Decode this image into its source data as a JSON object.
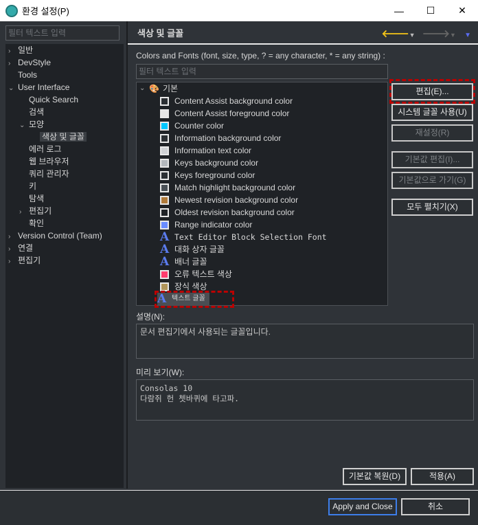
{
  "window": {
    "title": "환경 설정(P)",
    "controls": [
      "—",
      "☐",
      "✕"
    ]
  },
  "sidebar": {
    "filter_placeholder": "필터 텍스트 입력",
    "items": [
      {
        "label": "일반",
        "level": 0,
        "arrow": "›"
      },
      {
        "label": "DevStyle",
        "level": 0,
        "arrow": "›"
      },
      {
        "label": "Tools",
        "level": 0,
        "arrow": ""
      },
      {
        "label": "User Interface",
        "level": 0,
        "arrow": "⌄"
      },
      {
        "label": "Quick Search",
        "level": 1,
        "arrow": ""
      },
      {
        "label": "검색",
        "level": 1,
        "arrow": ""
      },
      {
        "label": "모양",
        "level": 1,
        "arrow": "⌄"
      },
      {
        "label": "색상 및 글꼴",
        "level": 2,
        "arrow": "",
        "selected": true
      },
      {
        "label": "에러 로그",
        "level": 1,
        "arrow": ""
      },
      {
        "label": "웹 브라우저",
        "level": 1,
        "arrow": ""
      },
      {
        "label": "쿼리 관리자",
        "level": 1,
        "arrow": ""
      },
      {
        "label": "키",
        "level": 1,
        "arrow": ""
      },
      {
        "label": "탐색",
        "level": 1,
        "arrow": ""
      },
      {
        "label": "편집기",
        "level": 1,
        "arrow": "›"
      },
      {
        "label": "확인",
        "level": 1,
        "arrow": ""
      },
      {
        "label": "Version Control (Team)",
        "level": 0,
        "arrow": "›"
      },
      {
        "label": "연결",
        "level": 0,
        "arrow": "›"
      },
      {
        "label": "편집기",
        "level": 0,
        "arrow": "›"
      }
    ]
  },
  "page": {
    "title": "색상 및 글꼴",
    "intro": "Colors and Fonts (font, size, type, ? = any character, * = any string) :",
    "filter_placeholder": "필터 텍스트 입력",
    "category": "기본",
    "entries": [
      {
        "label": "Content Assist background color",
        "type": "color",
        "color": "#2b2f33"
      },
      {
        "label": "Content Assist foreground color",
        "type": "color",
        "color": "#e6e6e6"
      },
      {
        "label": "Counter color",
        "type": "color",
        "color": "#00c8ff"
      },
      {
        "label": "Information background color",
        "type": "color",
        "color": "#2b2f33"
      },
      {
        "label": "Information text color",
        "type": "color",
        "color": "#cfd1d4"
      },
      {
        "label": "Keys background color",
        "type": "color",
        "color": "#b4b8bd"
      },
      {
        "label": "Keys foreground color",
        "type": "color",
        "color": "#2b2f33"
      },
      {
        "label": "Match highlight background color",
        "type": "color",
        "color": "#4a5056"
      },
      {
        "label": "Newest revision background color",
        "type": "color",
        "color": "#b07a3a"
      },
      {
        "label": "Oldest revision background color",
        "type": "color",
        "color": "#1f2226"
      },
      {
        "label": "Range indicator color",
        "type": "color",
        "color": "#6a8cff"
      },
      {
        "label": "Text Editor Block Selection Font",
        "type": "font",
        "mono": true
      },
      {
        "label": "대화 상자 글꼴",
        "type": "font"
      },
      {
        "label": "배너 글꼴",
        "type": "font"
      },
      {
        "label": "오류 텍스트 색상",
        "type": "color",
        "color": "#ff3d6e"
      },
      {
        "label": "장식 색상",
        "type": "color",
        "color": "#b0955a"
      },
      {
        "label": "텍스트 글꼴",
        "type": "font",
        "selected": true
      }
    ],
    "buttons": {
      "edit": "편집(E)...",
      "system_font": "시스템 글꼴 사용(U)",
      "reset": "재설정(R)",
      "edit_default": "기본값 편집(I)...",
      "goto_default": "기본값으로 가기(G)",
      "expand_all": "모두 펼치기(X)"
    },
    "description_label": "설명(N):",
    "description": "문서 편집기에서 사용되는 글꼴입니다.",
    "preview_label": "미리 보기(W):",
    "preview_font": "Consolas 10",
    "preview_text": "다람쥐 헌 쳇바퀴에 타고파.",
    "restore_defaults": "기본값 복원(D)",
    "apply": "적용(A)"
  },
  "footer": {
    "apply_close": "Apply and Close",
    "cancel": "취소"
  },
  "colors": {
    "highlight": "#b00000",
    "accent_back": "#f5c518",
    "focus": "#3d7eea"
  }
}
